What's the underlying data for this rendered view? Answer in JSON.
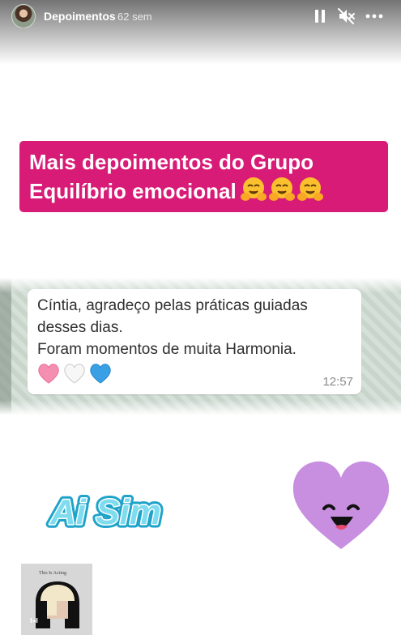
{
  "header": {
    "username": "Depoimentos",
    "timestamp": "62 sem",
    "icons": [
      "pause-icon",
      "mute-icon",
      "more-icon"
    ]
  },
  "title": {
    "line1": "Mais depoimentos do Grupo",
    "line2": "Equilíbrio emocional",
    "emoji": "hugging-face-emoji",
    "emoji_count": 3,
    "background_color": "#d81b76"
  },
  "chat": {
    "lines": [
      "Cíntia, agradeço pelas práticas guiadas",
      "desses dias.",
      "Foram momentos de muita Harmonia."
    ],
    "hearts": [
      "pink-heart-icon",
      "white-heart-icon",
      "blue-heart-icon"
    ],
    "time": "12:57"
  },
  "stickers": {
    "aisim_text": "Ai Sim",
    "heart": "smiling-purple-heart"
  },
  "music": {
    "album_title": "This Is Acting",
    "play_label": "I◂I"
  }
}
